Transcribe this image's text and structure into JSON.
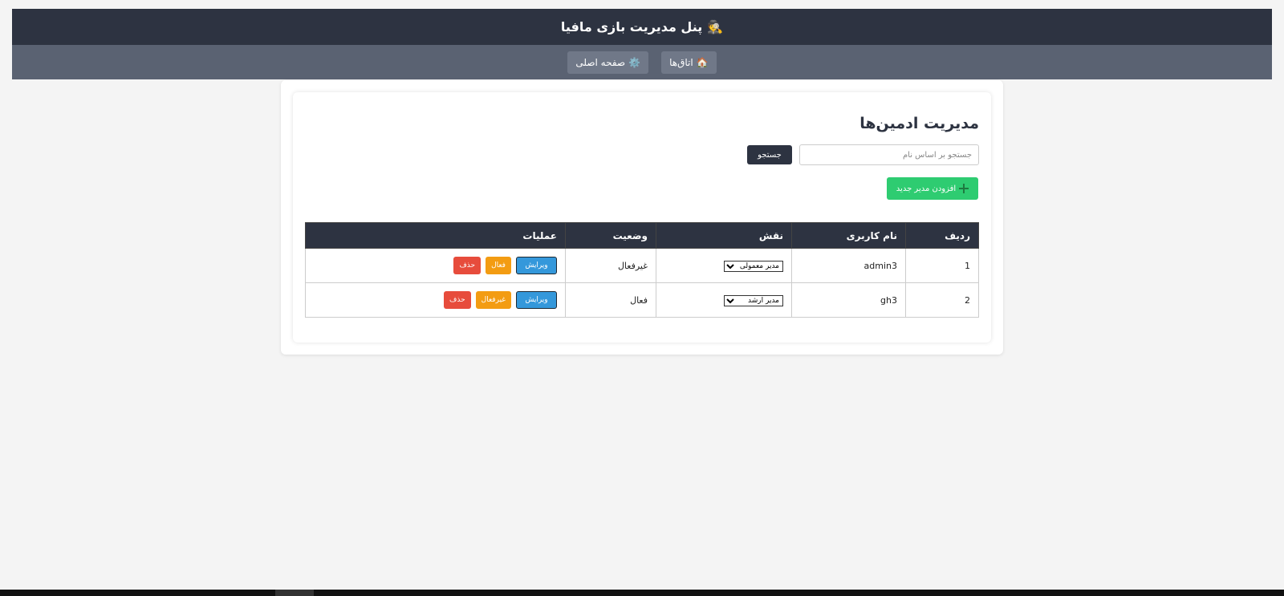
{
  "header": {
    "title": "پنل مدیریت بازی مافیا",
    "emoji": "🕵️"
  },
  "nav": {
    "rooms": "اتاق‌ها",
    "rooms_icon": "🏠",
    "home": "صفحه اصلی",
    "home_icon": "⚙️"
  },
  "main": {
    "title": "مدیریت ادمین‌ها",
    "search_placeholder": "جستجو بر اساس نام",
    "search_button": "جستجو",
    "add_button": "افزودن مدیر جدید"
  },
  "table": {
    "headers": {
      "index": "ردیف",
      "username": "نام کاربری",
      "role": "نقش",
      "status": "وضعیت",
      "actions": "عملیات"
    },
    "rows": [
      {
        "index": "1",
        "username": "admin3",
        "role": "مدیر معمولی",
        "status": "غیرفعال",
        "edit": "ویرایش",
        "toggle": "فعال",
        "delete": "حذف"
      },
      {
        "index": "2",
        "username": "gh3",
        "role": "مدیر ارشد",
        "status": "فعال",
        "edit": "ویرایش",
        "toggle": "غیرفعال",
        "delete": "حذف"
      }
    ]
  },
  "colors": {
    "header_bg": "#2d3341",
    "nav_bg": "#5a6272",
    "add_green": "#2ecc71",
    "edit_blue": "#3498db",
    "toggle_orange": "#f39c12",
    "delete_red": "#e74c3c"
  }
}
